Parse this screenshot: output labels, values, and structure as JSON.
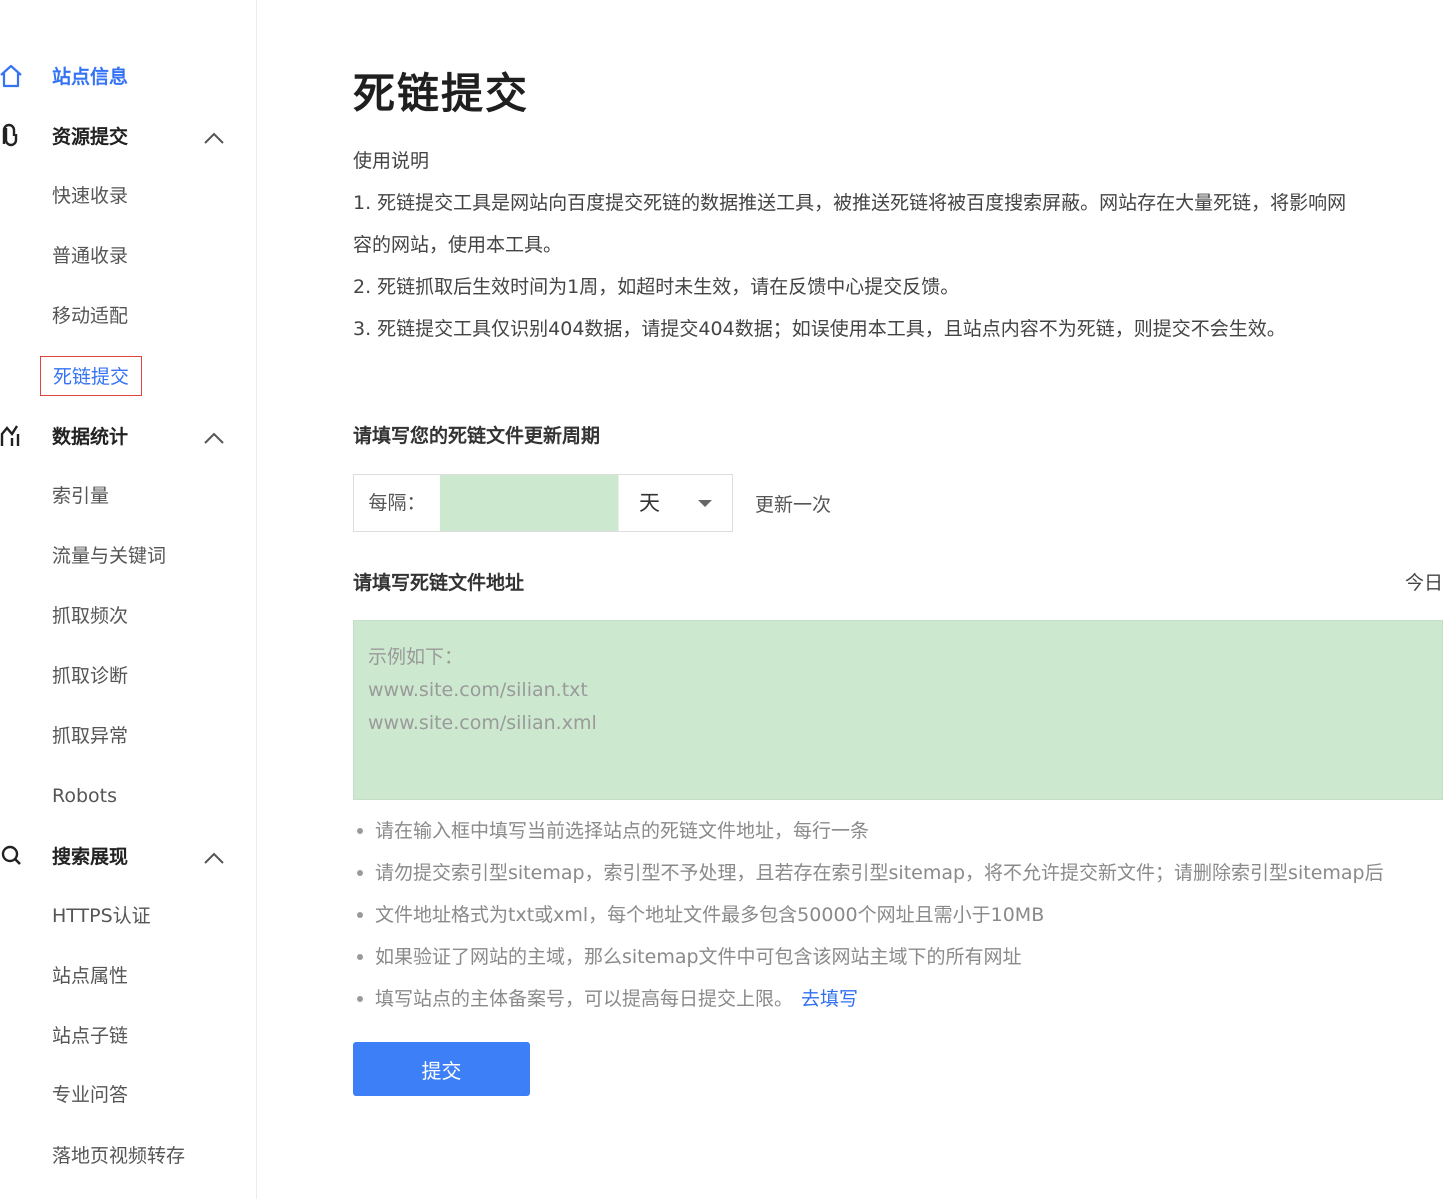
{
  "sidebar": {
    "site_info": "站点信息",
    "groups": [
      {
        "label": "资源提交",
        "items": [
          "快速收录",
          "普通收录",
          "移动适配",
          "死链提交"
        ]
      },
      {
        "label": "数据统计",
        "items": [
          "索引量",
          "流量与关键词",
          "抓取频次",
          "抓取诊断",
          "抓取异常",
          "Robots"
        ]
      },
      {
        "label": "搜索展现",
        "items": [
          "HTTPS认证",
          "站点属性",
          "站点子链",
          "专业问答",
          "落地页视频转存"
        ]
      }
    ]
  },
  "main": {
    "title": "死链提交",
    "usage_heading": "使用说明",
    "usage_lines": [
      "1. 死链提交工具是网站向百度提交死链的数据推送工具，被推送死链将被百度搜索屏蔽。网站存在大量死链，将影响网",
      "容的网站，使用本工具。",
      "2. 死链抓取后生效时间为1周，如超时未生效，请在反馈中心提交反馈。",
      "3. 死链提交工具仅识别404数据，请提交404数据；如误使用本工具，且站点内容不为死链，则提交不会生效。"
    ],
    "period_label": "请填写您的死链文件更新周期",
    "period_prefix": "每隔：",
    "period_value": "",
    "period_unit": "天",
    "period_suffix": "更新一次",
    "address_label": "请填写死链文件地址",
    "today_label": "今日",
    "address_placeholder": "示例如下：\nwww.site.com/silian.txt\nwww.site.com/silian.xml",
    "tips": [
      "请在输入框中填写当前选择站点的死链文件地址，每行一条",
      "请勿提交索引型sitemap，索引型不予处理，且若存在索引型sitemap，将不允许提交新文件；请删除索引型sitemap后",
      "文件地址格式为txt或xml，每个地址文件最多包含50000个网址且需小于10MB",
      "如果验证了网站的主域，那么sitemap文件中可包含该网站主域下的所有网址",
      "填写站点的主体备案号，可以提高每日提交上限。"
    ],
    "tip_link": "去填写",
    "submit_label": "提交"
  },
  "colors": {
    "accent": "#3473f5",
    "button": "#3d7ff6",
    "input_bg": "#cce8cf",
    "highlight_border": "#e0443a"
  }
}
